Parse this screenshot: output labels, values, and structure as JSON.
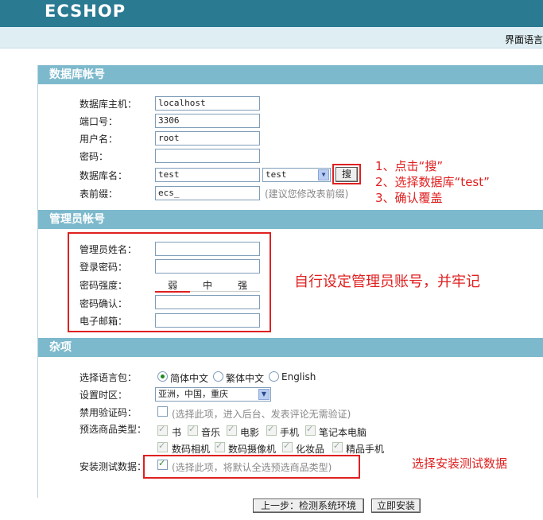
{
  "header": {
    "logo_text": "ECSHOP",
    "lang_link": "界面语言"
  },
  "db_section": {
    "title": "数据库帐号",
    "host_label": "数据库主机：",
    "host_value": "localhost",
    "port_label": "端口号：",
    "port_value": "3306",
    "user_label": "用户名：",
    "user_value": "root",
    "pass_label": "密码：",
    "pass_value": "",
    "dbname_label": "数据库名：",
    "dbname_value": "test",
    "dbname_select": "test",
    "search_button": "搜",
    "prefix_label": "表前缀：",
    "prefix_value": "ecs_",
    "prefix_hint": "(建议您修改表前缀)"
  },
  "admin_section": {
    "title": "管理员帐号",
    "name_label": "管理员姓名：",
    "pwd_label": "登录密码：",
    "strength_label": "密码强度：",
    "strength_weak": "弱",
    "strength_mid": "中",
    "strength_strong": "强",
    "confirm_label": "密码确认：",
    "email_label": "电子邮箱："
  },
  "misc_section": {
    "title": "杂项",
    "lang_label": "选择语言包：",
    "lang_options": [
      "简体中文",
      "繁体中文",
      "English"
    ],
    "tz_label": "设置时区：",
    "tz_value": "亚洲，中国，重庆",
    "captcha_label": "禁用验证码：",
    "captcha_hint": "(选择此项，进入后台、发表评论无需验证)",
    "goods_label": "预选商品类型：",
    "goods_types": [
      "书",
      "音乐",
      "电影",
      "手机",
      "笔记本电脑",
      "数码相机",
      "数码摄像机",
      "化妆品",
      "精品手机"
    ],
    "test_label": "安装测试数据：",
    "test_hint": "(选择此项，将默认全选预选商品类型)"
  },
  "annotations": {
    "step1": "1、点击“搜”",
    "step2": "2、选择数据库“test”",
    "step3": "3、确认覆盖",
    "admin_note": "自行设定管理员账号，并牢记",
    "test_note": "选择安装测试数据"
  },
  "footer": {
    "prev_button": "上一步：检测系统环境",
    "install_button": "立即安装"
  },
  "colors": {
    "topbar": "#2a7a92",
    "section_header": "#7db9cc",
    "annotation": "#e02020"
  }
}
